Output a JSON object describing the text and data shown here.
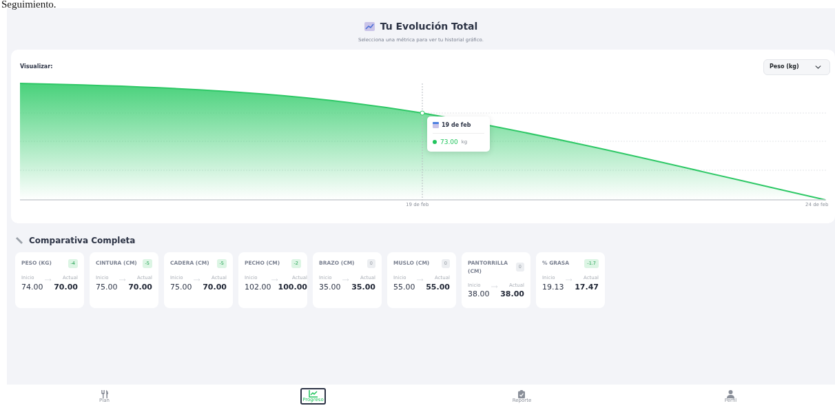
{
  "page_caption": "Seguimiento.",
  "header": {
    "title": "Tu Evolución Total",
    "subtitle": "Selecciona una métrica para ver tu historial gráfico."
  },
  "chart_card": {
    "label": "Visualizar:",
    "metric_select": {
      "value": "Peso (kg)"
    },
    "x_labels": [
      "19 de feb",
      "24 de feb"
    ],
    "tooltip": {
      "date": "19 de feb",
      "value": "73.00",
      "unit": "kg"
    }
  },
  "comparison": {
    "title": "Comparativa Completa",
    "cards": [
      {
        "label": "PESO (KG)",
        "change": "-4",
        "kind": "decrease",
        "start_label": "Inicio",
        "start": "74.00",
        "current_label": "Actual",
        "current": "70.00"
      },
      {
        "label": "CINTURA (CM)",
        "change": "-5",
        "kind": "decrease",
        "start_label": "Inicio",
        "start": "75.00",
        "current_label": "Actual",
        "current": "70.00"
      },
      {
        "label": "CADERA (CM)",
        "change": "-5",
        "kind": "decrease",
        "start_label": "Inicio",
        "start": "75.00",
        "current_label": "Actual",
        "current": "70.00"
      },
      {
        "label": "PECHO (CM)",
        "change": "-2",
        "kind": "decrease",
        "start_label": "Inicio",
        "start": "102.00",
        "current_label": "Actual",
        "current": "100.00"
      },
      {
        "label": "BRAZO (CM)",
        "change": "0",
        "kind": "unchanged",
        "start_label": "Inicio",
        "start": "35.00",
        "current_label": "Actual",
        "current": "35.00"
      },
      {
        "label": "MUSLO (CM)",
        "change": "0",
        "kind": "unchanged",
        "start_label": "Inicio",
        "start": "55.00",
        "current_label": "Actual",
        "current": "55.00"
      },
      {
        "label": "PANTORRILLA (CM)",
        "change": "0",
        "kind": "unchanged",
        "start_label": "Inicio",
        "start": "38.00",
        "current_label": "Actual",
        "current": "38.00"
      },
      {
        "label": "% GRASA",
        "change": "-1.7",
        "kind": "decrease",
        "start_label": "Inicio",
        "start": "19.13",
        "current_label": "Actual",
        "current": "17.47"
      }
    ]
  },
  "bottom_nav": [
    {
      "label": "Plan",
      "selected": false
    },
    {
      "label": "Progreso",
      "selected": true
    },
    {
      "label": "Reporte",
      "selected": false
    },
    {
      "label": "Perfil",
      "selected": false
    }
  ]
}
